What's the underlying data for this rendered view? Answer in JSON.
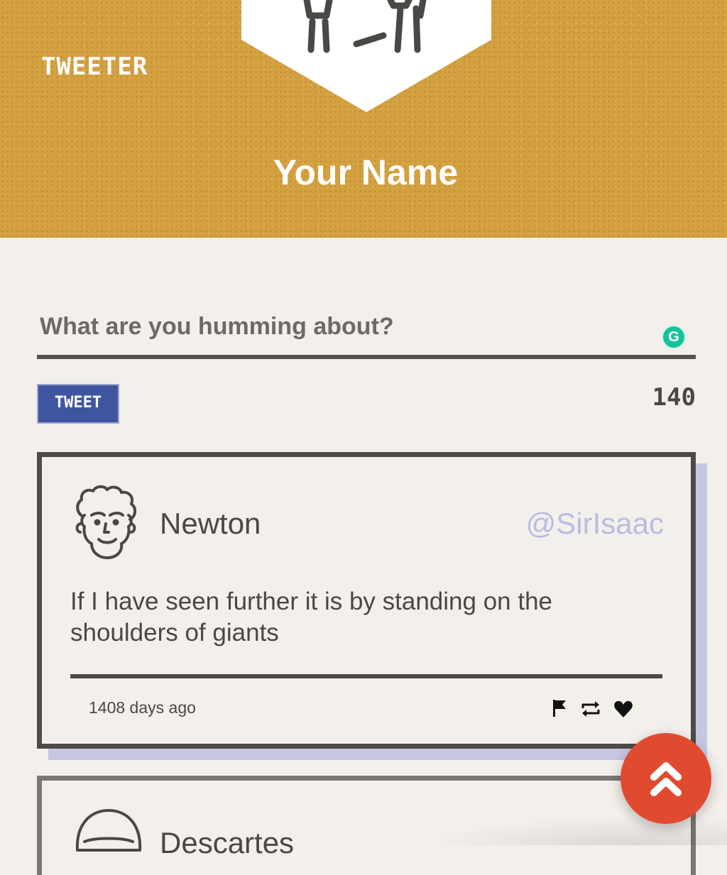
{
  "header": {
    "brand": "Tweeter",
    "profile_name": "Your Name"
  },
  "composer": {
    "placeholder": "What are you humming about?",
    "tweet_button": "Tweet",
    "char_count": "140"
  },
  "tweets": [
    {
      "author": "Newton",
      "handle": "@SirIsaac",
      "text": "If I have seen further it is by standing on the shoulders of giants",
      "time": "1408 days ago",
      "actions": [
        "flag-icon",
        "retweet-icon",
        "heart-icon"
      ]
    },
    {
      "author": "Descartes"
    }
  ],
  "colors": {
    "header_bg": "#d4a140",
    "tweet_button": "#4055a0",
    "handle": "#b9bce0",
    "fab": "#e04b30",
    "card_shadow": "#c6c8e2"
  },
  "icons": {
    "fab": "double-chevron-up-icon",
    "grammarly": "grammarly-icon"
  }
}
